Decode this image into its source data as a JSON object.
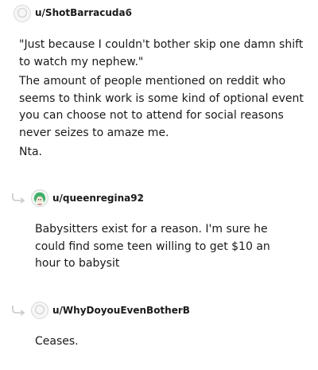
{
  "comments": [
    {
      "username": "u/ShotBarracuda6",
      "separator": "•",
      "avatar_icon": "default-user-avatar-icon",
      "paragraphs": [
        "\"Just because I couldn't bother skip one damn shift to watch my nephew.\"",
        "The amount of people mentioned on reddit who seems to think work is some kind of optional event you can choose not to attend for social reasons never seizes to amaze me.",
        "Nta."
      ]
    },
    {
      "username": "u/queenregina92",
      "separator": "•",
      "avatar_icon": "green-haired-character-avatar-icon",
      "reply_icon": "reply-arrow-icon",
      "paragraphs": [
        "Babysitters exist for a reason. I'm sure he could find some teen willing to get $10 an hour to babysit"
      ]
    },
    {
      "username": "u/WhyDoyouEvenBotherB",
      "separator": "•",
      "avatar_icon": "default-user-avatar-icon",
      "reply_icon": "reply-arrow-icon",
      "paragraphs": [
        "Ceases."
      ]
    }
  ]
}
